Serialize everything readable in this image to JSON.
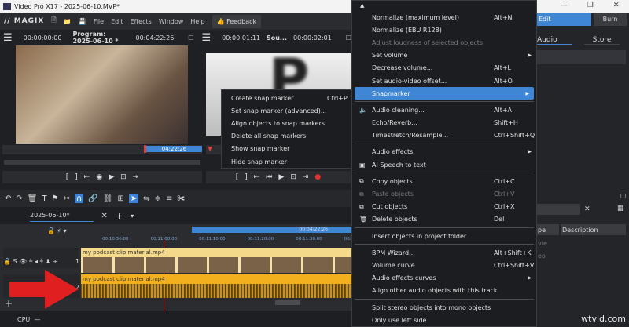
{
  "window": {
    "title": "Video Pro X17 - 2025-06-10.MVP*",
    "minimize": "—",
    "maximize": "❐",
    "close": "✕"
  },
  "menubar": {
    "logo": "// MAGIX",
    "items": [
      "File",
      "Edit",
      "Effects",
      "Window",
      "Help"
    ],
    "feedback": "Feedback"
  },
  "program_monitor": {
    "time_left": "00:00:00:00",
    "title": "Program: 2025-06-10 *",
    "time_right": "00:04:22:26",
    "range_label": "04:22:26"
  },
  "source_monitor": {
    "time_left": "00:00:01:11",
    "title": "Sou...",
    "time_right": "00:00:02:01",
    "preview_letter": "P"
  },
  "timeline": {
    "tab": "2025-06-10*",
    "range_label": "00:04:22:26",
    "ruler": [
      "00:10:50:00",
      "00:11:00:00",
      "00:11:10:00",
      "00:11:20:00",
      "00:11:30:00",
      "00:11:40:00"
    ],
    "tracks": [
      {
        "number": "1",
        "clip": "my podcast clip material.mp4",
        "controls": "S"
      },
      {
        "number": "2",
        "clip": "my podcast clip material.mp4"
      }
    ]
  },
  "status": {
    "cpu": "CPU: —"
  },
  "right_panel": {
    "edit": "Edit",
    "burn": "Burn",
    "tabs": [
      "Audio",
      "Store"
    ],
    "columns": [
      "pe",
      "Description"
    ],
    "rows": [
      "vie",
      "eo"
    ]
  },
  "context_menu": {
    "items": [
      {
        "label": "Normalize (maximum level)",
        "shortcut": "Alt+N"
      },
      {
        "label": "Normalize (EBU R128)"
      },
      {
        "label": "Adjust loudness of selected objects",
        "disabled": true
      },
      {
        "label": "Set volume",
        "submenu": true
      },
      {
        "label": "Decrease volume...",
        "shortcut": "Alt+L"
      },
      {
        "label": "Set audio-video offset...",
        "shortcut": "Alt+O"
      },
      {
        "label": "Snapmarker",
        "submenu": true,
        "highlighted": true
      },
      {
        "sep": true
      },
      {
        "label": "Audio cleaning...",
        "shortcut": "Alt+A",
        "icon": "🔈"
      },
      {
        "label": "Echo/Reverb...",
        "shortcut": "Shift+H"
      },
      {
        "label": "Timestretch/Resample...",
        "shortcut": "Ctrl+Shift+Q"
      },
      {
        "sep": true
      },
      {
        "label": "Audio effects",
        "submenu": true
      },
      {
        "label": "AI Speech to text",
        "icon": "▣"
      },
      {
        "sep": true
      },
      {
        "label": "Copy objects",
        "shortcut": "Ctrl+C",
        "icon": "⧉"
      },
      {
        "label": "Paste objects",
        "shortcut": "Ctrl+V",
        "disabled": true,
        "icon": "⧉"
      },
      {
        "label": "Cut objects",
        "shortcut": "Ctrl+X",
        "icon": "⧉"
      },
      {
        "label": "Delete objects",
        "shortcut": "Del",
        "icon": "🗑"
      },
      {
        "sep": true
      },
      {
        "label": "Insert objects in project folder"
      },
      {
        "sep": true
      },
      {
        "label": "BPM Wizard...",
        "shortcut": "Alt+Shift+K"
      },
      {
        "label": "Volume curve",
        "shortcut": "Ctrl+Shift+V"
      },
      {
        "label": "Audio effects curves",
        "submenu": true
      },
      {
        "label": "Align other audio objects with this track"
      },
      {
        "sep": true
      },
      {
        "label": "Split stereo objects into mono objects"
      },
      {
        "label": "Only use left side"
      }
    ]
  },
  "snap_submenu": {
    "items": [
      {
        "label": "Create snap marker",
        "shortcut": "Ctrl+P"
      },
      {
        "label": "Set snap marker (advanced)..."
      },
      {
        "label": "Align objects to snap markers"
      },
      {
        "label": "Delete all snap markers"
      },
      {
        "label": "Show snap marker"
      },
      {
        "label": "Hide snap marker"
      }
    ]
  },
  "watermark": "wtvid.com",
  "colors": {
    "accent": "#3f86d4",
    "clip_video": "#f5d98a",
    "clip_audio": "#f2b01e",
    "arrow": "#e02020"
  }
}
